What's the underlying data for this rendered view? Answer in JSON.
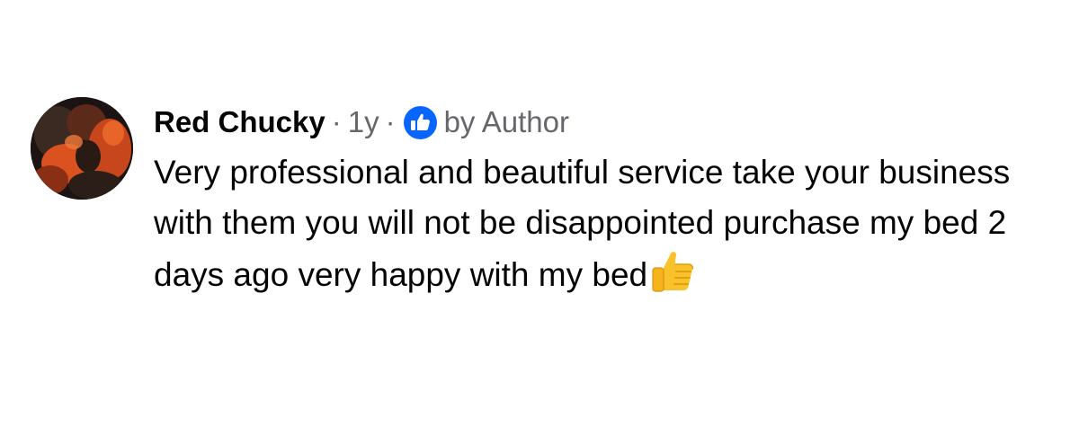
{
  "comment": {
    "author_name": "Red Chucky",
    "separator": "·",
    "timestamp": "1y",
    "badge_icon": "like-thumb-icon",
    "badge_label": "by Author",
    "text": "Very professional and beautiful service take your business with them you will not be disappointed purchase my bed 2 days ago very happy with my bed",
    "emoji": "thumbs-up-emoji-icon"
  },
  "colors": {
    "text": "#050505",
    "secondary": "#65676b",
    "brand_blue": "#0866ff",
    "background": "#ffffff"
  }
}
